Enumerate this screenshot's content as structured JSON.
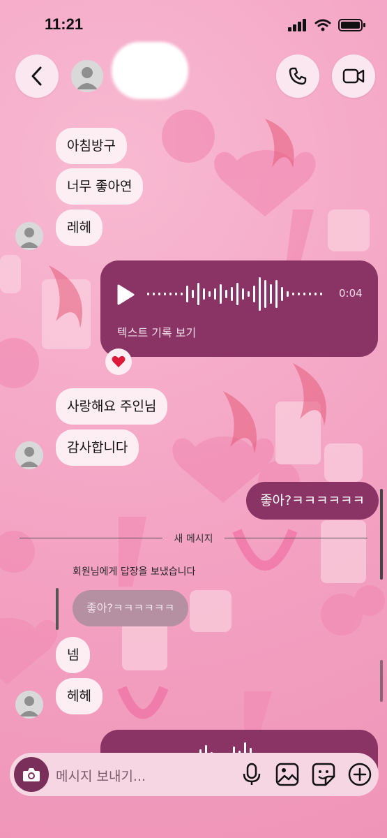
{
  "status_bar": {
    "time": "11:21"
  },
  "header": {
    "back_icon": "chevron-left-icon",
    "call_icon": "phone-icon",
    "video_icon": "video-camera-icon"
  },
  "messages": {
    "m1": "아침방구",
    "m2": "너무 좋아연",
    "m3": "레헤",
    "voice_duration": "0:04",
    "voice_transcript": "텍스트 기록 보기",
    "reaction": "❤️",
    "m4": "사랑해요 주인님",
    "m5": "감사합니다",
    "out1": "좋아?ㅋㅋㅋㅋㅋㅋ",
    "new_messages": "새 메시지",
    "reply_label": "회원님에게 답장을 보냈습니다",
    "reply_quote": "좋아?ㅋㅋㅋㅋㅋㅋ",
    "m6": "넴",
    "m7": "헤헤"
  },
  "composer": {
    "placeholder": "메시지 보내기..."
  },
  "colors": {
    "outgoing": "#8a3466",
    "incoming": "#fdeef3",
    "background": "#f4a9c6"
  }
}
